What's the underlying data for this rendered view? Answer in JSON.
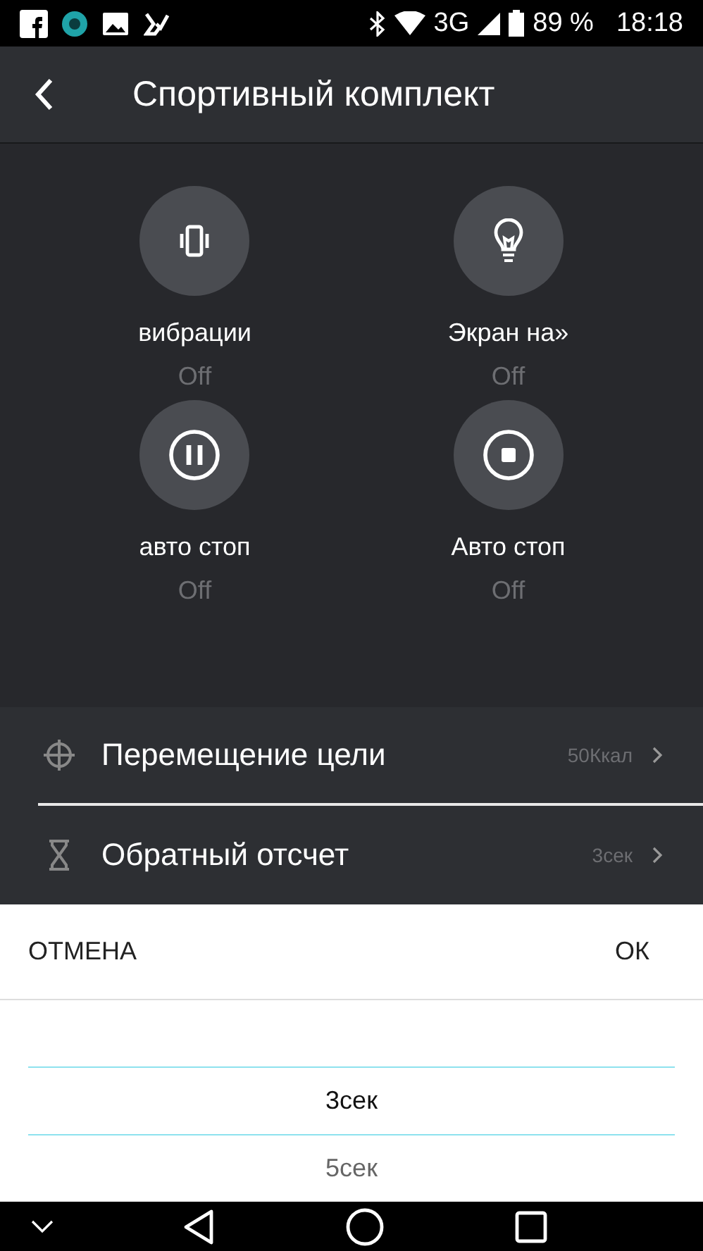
{
  "status_bar": {
    "network": "3G",
    "battery": "89 %",
    "time": "18:18"
  },
  "app_bar": {
    "title": "Спортивный комплект"
  },
  "tiles": [
    {
      "label": "вибрации",
      "value": "Off"
    },
    {
      "label": "Экран на»",
      "value": "Off"
    },
    {
      "label": "авто стоп",
      "value": "Off"
    },
    {
      "label": "Авто стоп",
      "value": "Off"
    }
  ],
  "settings": [
    {
      "label": "Перемещение цели",
      "value": "50Ккал"
    },
    {
      "label": "Обратный отсчет",
      "value": "3сек"
    }
  ],
  "dialog": {
    "cancel": "ОТМЕНА",
    "ok": "ОК",
    "options": [
      {
        "label": "3сек",
        "selected": true
      },
      {
        "label": "5сек",
        "selected": false
      }
    ]
  }
}
